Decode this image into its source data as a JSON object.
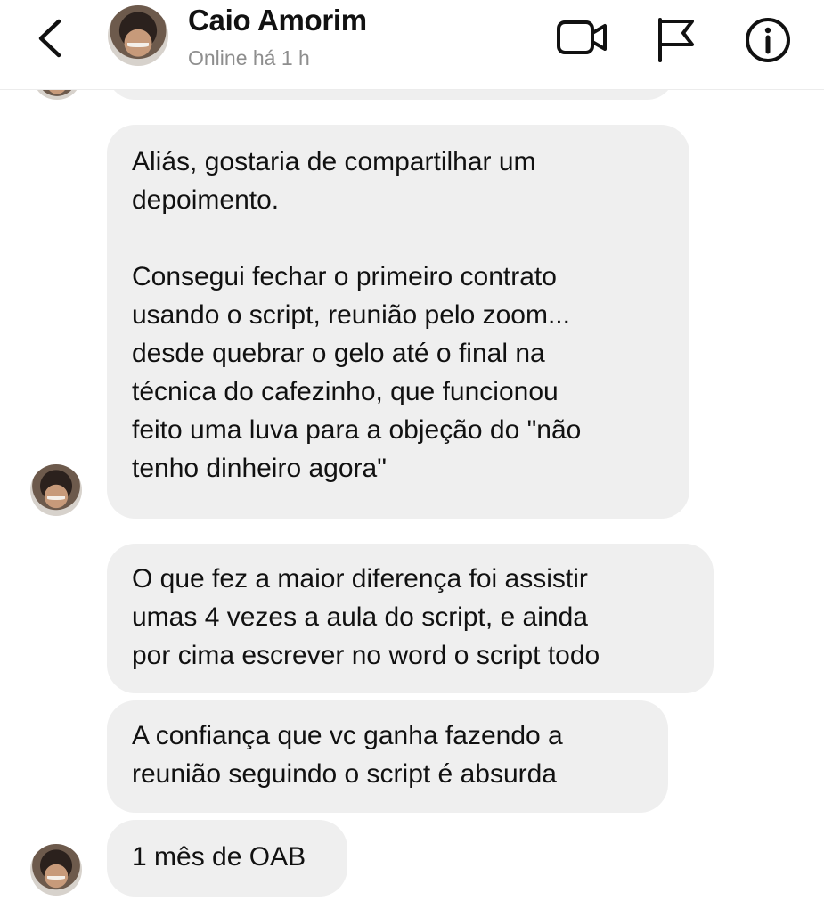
{
  "header": {
    "contact_name": "Caio Amorim",
    "status": "Online há 1 h",
    "icons": [
      "back-chevron-icon",
      "video-call-icon",
      "flag-icon",
      "info-icon"
    ]
  },
  "messages": [
    {
      "text": "Aliás, gostaria de compartilhar um\ndepoimento.\n\nConsegui fechar o primeiro contrato\nusando o script, reunião pelo zoom...\ndesde quebrar o gelo até o final na\ntécnica do cafezinho, que funcionou\nfeito uma luva para a objeção do \"não\ntenho dinheiro agora\""
    },
    {
      "text": "O que fez a maior diferença foi assistir\numas 4 vezes a aula do script, e ainda\npor cima escrever no word o script todo"
    },
    {
      "text": "A confiança que vc ganha fazendo a\nreunião seguindo o script é absurda"
    },
    {
      "text": "1 mês de OAB"
    }
  ],
  "colors": {
    "bubble": "#efefef",
    "status": "#8e8e8e",
    "text": "#111111"
  }
}
